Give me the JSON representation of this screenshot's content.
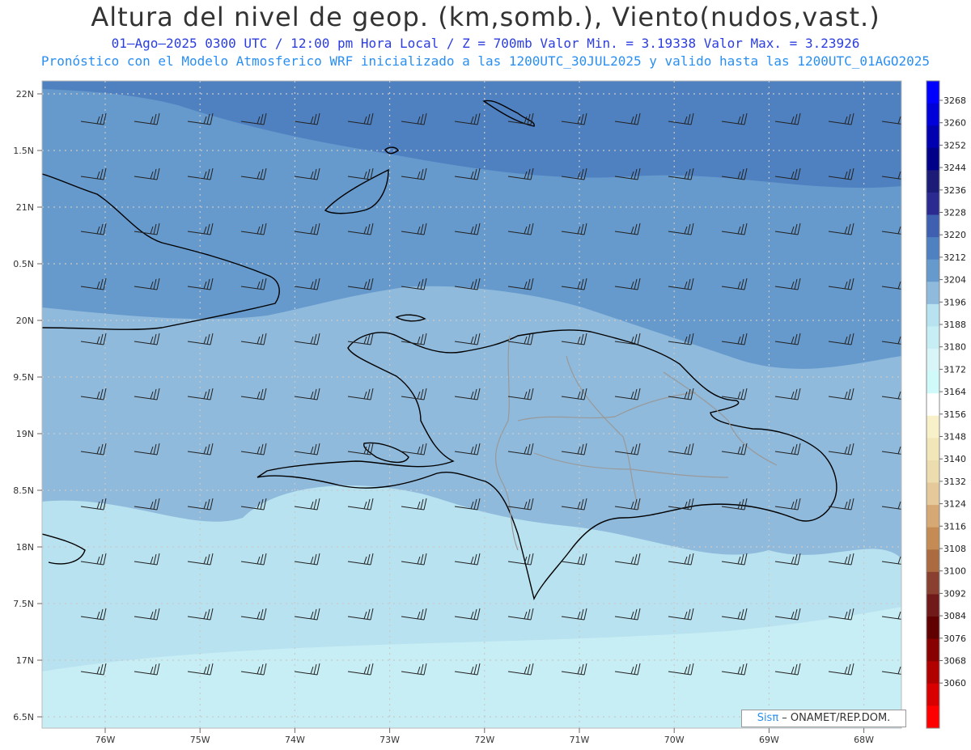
{
  "title": "Altura del nivel de geop. (km,somb.), Viento(nudos,vast.)",
  "subtitle_1": "01–Ago–2025  0300 UTC / 12:00 pm Hora Local / Z = 700mb   Valor Min. = 3.19338  Valor Max. = 3.23926",
  "subtitle_2": "Pronóstico con el Modelo Atmosferico WRF inicializado a las 1200UTC_30JUL2025 y valido hasta las  1200UTC_01AGO2025",
  "lat_labels": [
    "22N",
    "1.5N",
    "21N",
    "0.5N",
    "20N",
    "9.5N",
    "19N",
    "8.5N",
    "18N",
    "7.5N",
    "17N",
    "6.5N"
  ],
  "lon_labels": [
    "76W",
    "75W",
    "74W",
    "73W",
    "72W",
    "71W",
    "70W",
    "69W",
    "68W"
  ],
  "colorbar": {
    "labels": [
      "3268",
      "3260",
      "3252",
      "3244",
      "3236",
      "3228",
      "3220",
      "3212",
      "3204",
      "3196",
      "3188",
      "3180",
      "3172",
      "3164",
      "3156",
      "3148",
      "3140",
      "3132",
      "3124",
      "3116",
      "3108",
      "3100",
      "3092",
      "3084",
      "3076",
      "3068",
      "3060"
    ],
    "colors": [
      "#0000ff",
      "#0000d8",
      "#0000b0",
      "#000088",
      "#1c1c78",
      "#2a2a90",
      "#3f5fb0",
      "#4f80c0",
      "#6699cc",
      "#8fbadc",
      "#b8e2f0",
      "#c8eef5",
      "#d8f5f8",
      "#d0fafa",
      "#ffffff",
      "#f8f0c8",
      "#f0e6b8",
      "#ecdcae",
      "#e5c99a",
      "#d6a874",
      "#c48c54",
      "#ac6a40",
      "#8a4030",
      "#701a1a",
      "#600000",
      "#880000",
      "#b00000",
      "#d80000",
      "#ff0000"
    ]
  },
  "credit": {
    "brand": "Sisπ",
    "text": " – ONAMET/REP.DOM."
  },
  "icons": {
    "wind_barb": "wind-barb-icon"
  }
}
